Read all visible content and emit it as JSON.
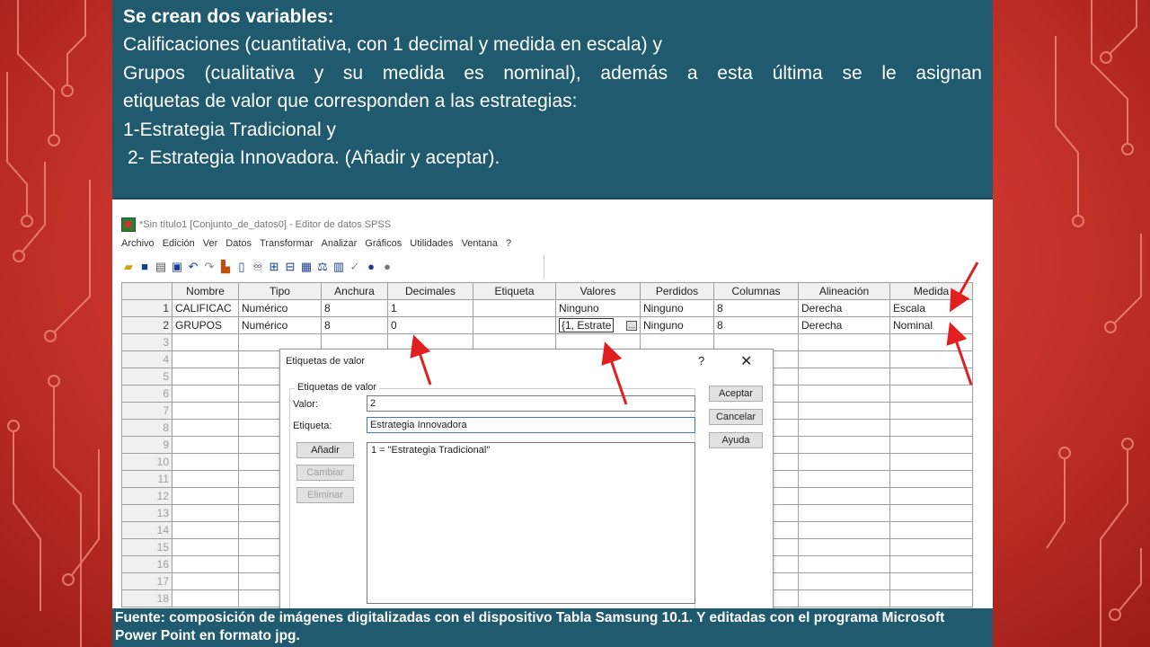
{
  "slide": {
    "title_bold": "Se crean dos variables:",
    "line2": "Calificaciones (cuantitativa, con 1 decimal y medida en escala) y",
    "line3": "Grupos (cualitativa y su medida es nominal), además a esta última se le asignan",
    "line4": "etiquetas de valor que corresponden a las estrategias:",
    "line5": "1-Estrategia Tradicional y",
    "line6": "2- Estrategia Innovadora.  (Añadir y aceptar).",
    "footer": "Fuente: composición de imágenes digitalizadas con el  dispositivo Tabla Samsung 10.1. Y editadas con el programa Microsoft Power Point en formato jpg."
  },
  "spss": {
    "window_title": "*Sin título1 [Conjunto_de_datos0] - Editor de datos SPSS",
    "menu": [
      "Archivo",
      "Edición",
      "Ver",
      "Datos",
      "Transformar",
      "Analizar",
      "Gráficos",
      "Utilidades",
      "Ventana",
      "?"
    ],
    "columns": [
      "Nombre",
      "Tipo",
      "Anchura",
      "Decimales",
      "Etiqueta",
      "Valores",
      "Perdidos",
      "Columnas",
      "Alineación",
      "Medida"
    ],
    "rows": [
      {
        "n": "1",
        "nombre": "CALIFICAC",
        "tipo": "Numérico",
        "anchura": "8",
        "decimales": "1",
        "etiqueta": "",
        "valores": "Ninguno",
        "perdidos": "Ninguno",
        "columnas": "8",
        "alineacion": "Derecha",
        "medida": "Escala"
      },
      {
        "n": "2",
        "nombre": "GRUPOS",
        "tipo": "Numérico",
        "anchura": "8",
        "decimales": "0",
        "etiqueta": "",
        "valores": "{1, Estrate",
        "perdidos": "Ninguno",
        "columnas": "8",
        "alineacion": "Derecha",
        "medida": "Nominal"
      }
    ],
    "empty_rows": [
      "3",
      "4",
      "5",
      "6",
      "7",
      "8",
      "9",
      "10",
      "11",
      "12",
      "13",
      "14",
      "15",
      "16",
      "17",
      "18"
    ],
    "values_button": "...",
    "dialog": {
      "title": "Etiquetas de valor",
      "help_glyph": "?",
      "close_glyph": "✕",
      "group_label": "Etiquetas de valor",
      "valor_label": "Valor:",
      "valor_value": "2",
      "etiqueta_label": "Etiqueta:",
      "etiqueta_value": "Estrategia Innovadora",
      "list_items": [
        "1 = \"Estrategia Tradicional\""
      ],
      "buttons": {
        "add": "Añadir",
        "change": "Cambiar",
        "remove": "Eliminar",
        "ok": "Aceptar",
        "cancel": "Cancelar",
        "help": "Ayuda"
      }
    }
  },
  "colors": {
    "background": "#d23a30",
    "title_box": "#1f5a6e",
    "arrow": "#e02020"
  }
}
